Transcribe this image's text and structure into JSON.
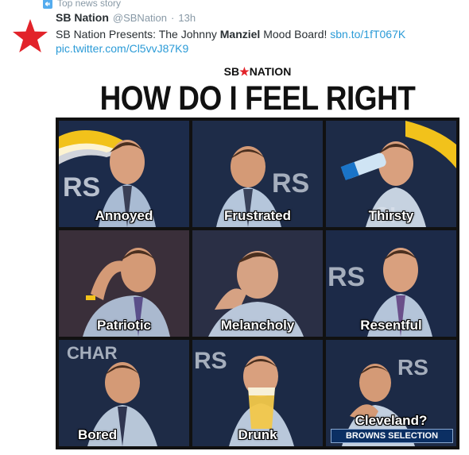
{
  "context": {
    "label": "Top news story",
    "icon": "megaphone-icon"
  },
  "tweet": {
    "author_name": "SB Nation",
    "author_handle": "@SBNation",
    "separator": "·",
    "time": "13h",
    "avatar_icon": "red-star-icon",
    "text_pre": "SB Nation Presents: The Johnny ",
    "text_bold": "Manziel",
    "text_post": " Mood Board! ",
    "link_1": "sbn.to/1fT067K",
    "link_2": "pic.twitter.com/Cl5vvJ87K9",
    "link_color": "#2b9bd7",
    "avatar_color": "#e2232a"
  },
  "media": {
    "brand_left": "SB",
    "brand_star": "★",
    "brand_right": "NATION",
    "headline": "HOW DO I FEEL RIGHT NOW?",
    "cells": [
      {
        "caption": "Annoyed"
      },
      {
        "caption": "Frustrated"
      },
      {
        "caption": "Thirsty"
      },
      {
        "caption": "Patriotic"
      },
      {
        "caption": "Melancholy"
      },
      {
        "caption": "Resentful"
      },
      {
        "caption": "Bored"
      },
      {
        "caption": "Drunk"
      },
      {
        "caption": "Cleveland?"
      }
    ],
    "banner": "BROWNS SELECTION"
  }
}
